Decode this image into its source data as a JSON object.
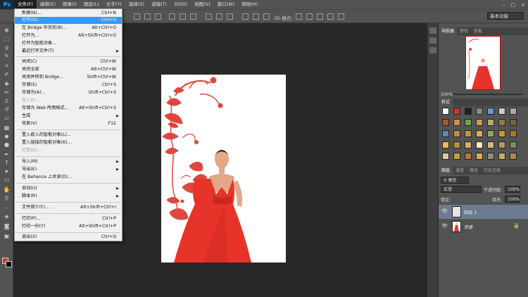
{
  "app": {
    "logo": "Ps"
  },
  "menubar": {
    "items": [
      "文件(F)",
      "编辑(E)",
      "图像(I)",
      "图层(L)",
      "文字(Y)",
      "选择(S)",
      "滤镜(T)",
      "3D(D)",
      "视图(V)",
      "窗口(W)",
      "帮助(H)"
    ],
    "win_min": "–",
    "win_max": "□",
    "win_close": "×"
  },
  "options": {
    "mode_3d": "3D 模式:",
    "workspace": "基本功能"
  },
  "file_menu": [
    {
      "label": "新建(N)...",
      "shortcut": "Ctrl+N"
    },
    {
      "label": "打开(O)...",
      "shortcut": "Ctrl+O",
      "highlighted": true
    },
    {
      "label": "在 Bridge 中浏览(B)...",
      "shortcut": "Alt+Ctrl+O"
    },
    {
      "label": "打开为...",
      "shortcut": "Alt+Shift+Ctrl+O"
    },
    {
      "label": "打开为智能对象...",
      "shortcut": ""
    },
    {
      "label": "最近打开文件(T)",
      "shortcut": "",
      "submenu": true
    },
    {
      "label": "关闭(C)",
      "shortcut": "Ctrl+W"
    },
    {
      "label": "关闭全部",
      "shortcut": "Alt+Ctrl+W"
    },
    {
      "label": "关闭并转到 Bridge...",
      "shortcut": "Shift+Ctrl+W"
    },
    {
      "label": "存储(S)",
      "shortcut": "Ctrl+S"
    },
    {
      "label": "存储为(A)...",
      "shortcut": "Shift+Ctrl+S"
    },
    {
      "label": "签入(I)...",
      "shortcut": "",
      "disabled": true
    },
    {
      "label": "存储为 Web 所用格式...",
      "shortcut": "Alt+Shift+Ctrl+S"
    },
    {
      "label": "生成",
      "shortcut": "",
      "submenu": true
    },
    {
      "label": "恢复(V)",
      "shortcut": "F12"
    },
    {
      "label": "置入嵌入的智能对象(L)...",
      "shortcut": ""
    },
    {
      "label": "置入链接的智能对象(K)...",
      "shortcut": ""
    },
    {
      "label": "打包(G)...",
      "shortcut": "",
      "disabled": true
    },
    {
      "label": "导入(M)",
      "shortcut": "",
      "submenu": true
    },
    {
      "label": "导出(E)",
      "shortcut": "",
      "submenu": true
    },
    {
      "label": "在 Behance 上共享(D)...",
      "shortcut": ""
    },
    {
      "label": "自动(U)",
      "shortcut": "",
      "submenu": true
    },
    {
      "label": "脚本(R)",
      "shortcut": "",
      "submenu": true
    },
    {
      "label": "文件简介(F)...",
      "shortcut": "Alt+Shift+Ctrl+I"
    },
    {
      "label": "打印(P)...",
      "shortcut": "Ctrl+P"
    },
    {
      "label": "打印一份(Y)",
      "shortcut": "Alt+Shift+Ctrl+P"
    },
    {
      "label": "退出(X)",
      "shortcut": "Ctrl+Q"
    }
  ],
  "navigator": {
    "tabs": [
      "导航器",
      "颜色",
      "色板"
    ],
    "zoom": "100%"
  },
  "styles": {
    "tab": "样式"
  },
  "layers": {
    "tabs": [
      "图层",
      "通道",
      "路径",
      "历史记录"
    ],
    "filter_kind": "类型",
    "blend_mode": "正常",
    "opacity_label": "不透明度:",
    "opacity": "100%",
    "lock_label": "锁定:",
    "fill_label": "填充:",
    "fill": "100%",
    "items": [
      {
        "name": "图层 1",
        "selected": true
      },
      {
        "name": "背景",
        "locked": true
      }
    ]
  },
  "colors": {
    "highlight": "#3399ff",
    "foreground": "#e8332a",
    "background": "#000000",
    "dress": "#e8332a"
  }
}
